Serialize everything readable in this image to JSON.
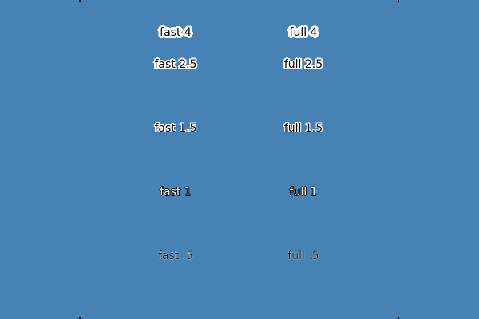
{
  "background_color": "#4682b4",
  "labels": {
    "fast_4": "fast 4",
    "full_4": "full 4",
    "fast_2_5": "fast 2.5",
    "full_2_5": "full 2.5",
    "fast_1_5": "fast 1.5",
    "full_1_5": "full 1.5",
    "fast_1": "fast 1",
    "full_1": "full 1",
    "fast_0_5": "fast .5",
    "full_0_5": "full .5"
  }
}
